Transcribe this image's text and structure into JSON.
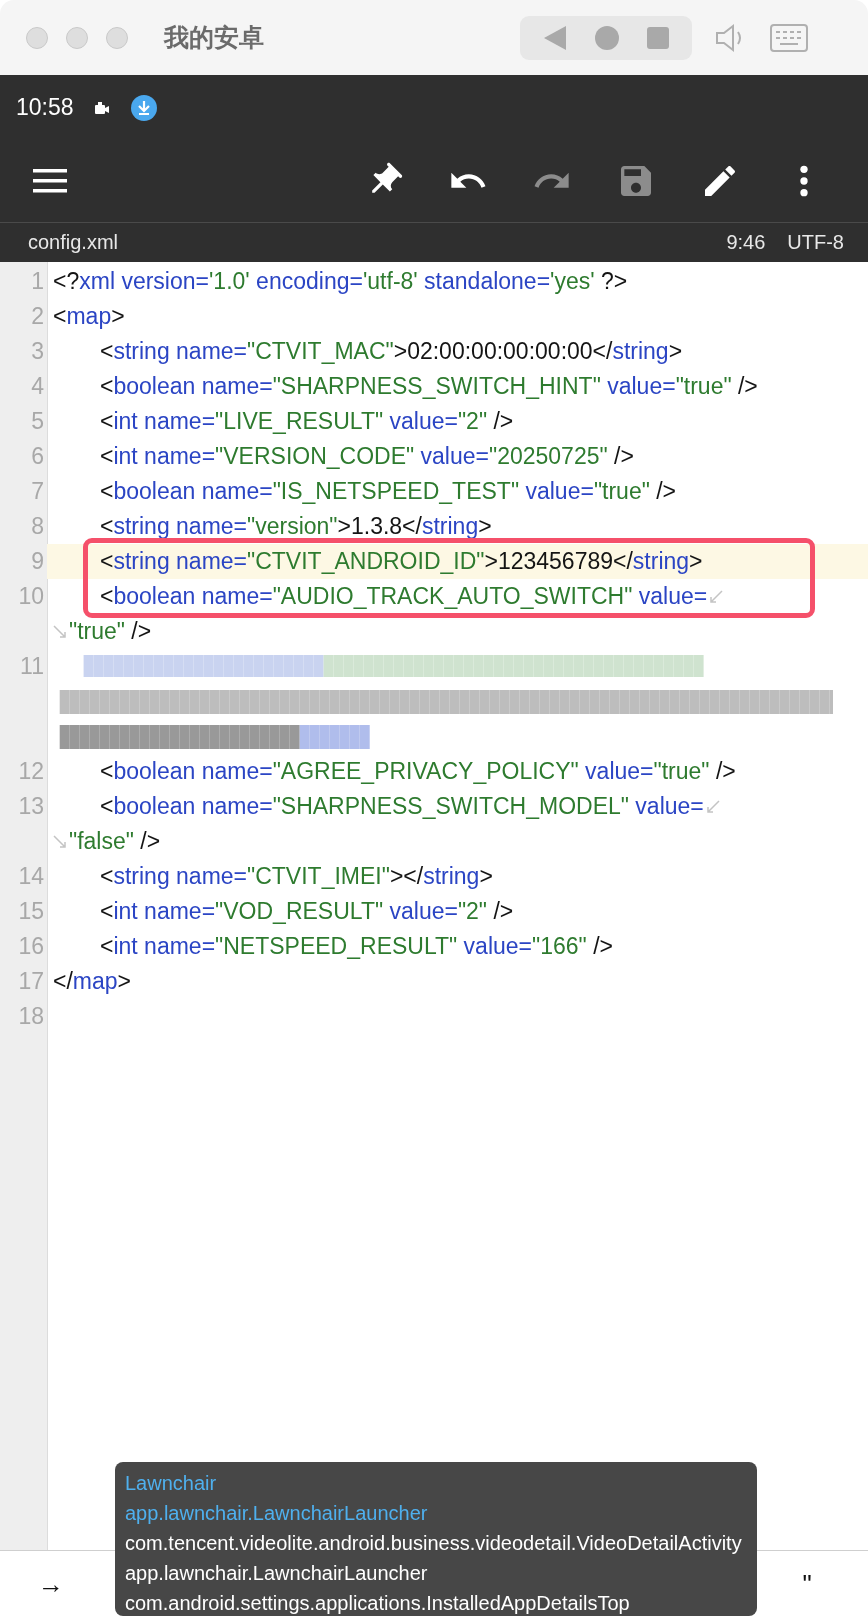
{
  "window": {
    "title": "我的安卓"
  },
  "status_bar": {
    "time": "10:58"
  },
  "toolbar": {
    "actions": [
      {
        "kind": "pin",
        "disabled": false
      },
      {
        "kind": "undo",
        "disabled": false
      },
      {
        "kind": "redo",
        "disabled": true
      },
      {
        "kind": "save",
        "disabled": true
      },
      {
        "kind": "edit",
        "disabled": false
      },
      {
        "kind": "more",
        "disabled": false
      }
    ]
  },
  "file_bar": {
    "name": "config.xml",
    "position": "9:46",
    "encoding": "UTF-8"
  },
  "editor": {
    "lines": [
      {
        "number": "1",
        "kind": "code",
        "selected": false,
        "boxed": false,
        "tokens": [
          {
            "kind": "text",
            "text": "<?"
          },
          {
            "kind": "tag",
            "text": "xml version="
          },
          {
            "kind": "value",
            "text": "'1.0'"
          },
          {
            "kind": "tag",
            "text": " encoding="
          },
          {
            "kind": "value",
            "text": "'utf-8'"
          },
          {
            "kind": "tag",
            "text": " standalone="
          },
          {
            "kind": "value",
            "text": "'yes'"
          },
          {
            "kind": "text",
            "text": " ?>"
          }
        ]
      },
      {
        "number": "2",
        "kind": "code",
        "selected": false,
        "boxed": false,
        "tokens": [
          {
            "kind": "text",
            "text": "<"
          },
          {
            "kind": "tag",
            "text": "map"
          },
          {
            "kind": "text",
            "text": ">"
          }
        ],
        "children": [
          {
            "number": "3",
            "kind": "code",
            "selected": false,
            "boxed": false,
            "tokens": [
              {
                "kind": "text",
                "text": "<"
              },
              {
                "kind": "tag",
                "text": "string name="
              },
              {
                "kind": "value",
                "text": "\"CTVIT_MAC\""
              },
              {
                "kind": "text",
                "text": ">02:00:00:00:00:00</"
              },
              {
                "kind": "tag",
                "text": "string"
              },
              {
                "kind": "text",
                "text": ">"
              }
            ]
          },
          {
            "number": "4",
            "kind": "code",
            "selected": false,
            "boxed": false,
            "tokens": [
              {
                "kind": "text",
                "text": "<"
              },
              {
                "kind": "tag",
                "text": "boolean name="
              },
              {
                "kind": "value",
                "text": "\"SHARPNESS_SWITCH_HINT\""
              },
              {
                "kind": "tag",
                "text": " value="
              },
              {
                "kind": "value",
                "text": "\"true\""
              },
              {
                "kind": "text",
                "text": " />"
              }
            ]
          },
          {
            "number": "5",
            "kind": "code",
            "selected": false,
            "boxed": false,
            "tokens": [
              {
                "kind": "text",
                "text": "<"
              },
              {
                "kind": "tag",
                "text": "int name="
              },
              {
                "kind": "value",
                "text": "\"LIVE_RESULT\""
              },
              {
                "kind": "tag",
                "text": " value="
              },
              {
                "kind": "value",
                "text": "\"2\""
              },
              {
                "kind": "text",
                "text": " />"
              }
            ]
          },
          {
            "number": "6",
            "kind": "code",
            "selected": false,
            "boxed": false,
            "tokens": [
              {
                "kind": "text",
                "text": "<"
              },
              {
                "kind": "tag",
                "text": "int name="
              },
              {
                "kind": "value",
                "text": "\"VERSION_CODE\""
              },
              {
                "kind": "tag",
                "text": " value="
              },
              {
                "kind": "value",
                "text": "\"20250725\""
              },
              {
                "kind": "text",
                "text": " />"
              }
            ]
          },
          {
            "number": "7",
            "kind": "code",
            "selected": false,
            "boxed": false,
            "tokens": [
              {
                "kind": "text",
                "text": "<"
              },
              {
                "kind": "tag",
                "text": "boolean name="
              },
              {
                "kind": "value",
                "text": "\"IS_NETSPEED_TEST\""
              },
              {
                "kind": "tag",
                "text": " value="
              },
              {
                "kind": "value",
                "text": "\"true\""
              },
              {
                "kind": "text",
                "text": " />"
              }
            ]
          },
          {
            "number": "8",
            "kind": "code",
            "selected": false,
            "boxed": false,
            "tokens": [
              {
                "kind": "text",
                "text": "<"
              },
              {
                "kind": "tag",
                "text": "string name="
              },
              {
                "kind": "value",
                "text": "\"version\""
              },
              {
                "kind": "text",
                "text": ">1.3.8</"
              },
              {
                "kind": "tag",
                "text": "string"
              },
              {
                "kind": "text",
                "text": ">"
              }
            ]
          },
          {
            "number": "9",
            "kind": "code",
            "selected": true,
            "boxed": true,
            "tokens": [
              {
                "kind": "text",
                "text": "<"
              },
              {
                "kind": "tag",
                "text": "string name="
              },
              {
                "kind": "value",
                "text": "\"CTVIT_ANDROID_ID\""
              },
              {
                "kind": "text",
                "text": ">123456789</"
              },
              {
                "kind": "tag",
                "text": "string"
              },
              {
                "kind": "text",
                "text": ">"
              }
            ]
          },
          {
            "number": "10",
            "kind": "code",
            "selected": false,
            "boxed": true,
            "tokens": [
              {
                "kind": "text",
                "text": "<"
              },
              {
                "kind": "tag",
                "text": "boolean name="
              },
              {
                "kind": "value",
                "text": "\"AUDIO_TRACK_AUTO_SWITCH\""
              },
              {
                "kind": "tag",
                "text": " value="
              }
            ],
            "wrap": [
              {
                "kind": "value",
                "text": "\"true\""
              },
              {
                "kind": "text",
                "text": " />"
              }
            ]
          },
          {
            "number": "11",
            "kind": "blurred",
            "selected": false,
            "boxed": false
          },
          {
            "number": "12",
            "kind": "code",
            "selected": false,
            "boxed": false,
            "tokens": [
              {
                "kind": "text",
                "text": "<"
              },
              {
                "kind": "tag",
                "text": "boolean name="
              },
              {
                "kind": "value",
                "text": "\"AGREE_PRIVACY_POLICY\""
              },
              {
                "kind": "tag",
                "text": " value="
              },
              {
                "kind": "value",
                "text": "\"true\""
              },
              {
                "kind": "text",
                "text": " />"
              }
            ]
          },
          {
            "number": "13",
            "kind": "code",
            "selected": false,
            "boxed": false,
            "tokens": [
              {
                "kind": "text",
                "text": "<"
              },
              {
                "kind": "tag",
                "text": "boolean name="
              },
              {
                "kind": "value",
                "text": "\"SHARPNESS_SWITCH_MODEL\""
              },
              {
                "kind": "tag",
                "text": " value="
              }
            ],
            "wrap": [
              {
                "kind": "value",
                "text": "\"false\""
              },
              {
                "kind": "text",
                "text": " />"
              }
            ]
          },
          {
            "number": "14",
            "kind": "code",
            "selected": false,
            "boxed": false,
            "tokens": [
              {
                "kind": "text",
                "text": "<"
              },
              {
                "kind": "tag",
                "text": "string name="
              },
              {
                "kind": "value",
                "text": "\"CTVIT_IMEI\""
              },
              {
                "kind": "text",
                "text": "></"
              },
              {
                "kind": "tag",
                "text": "string"
              },
              {
                "kind": "text",
                "text": ">"
              }
            ]
          },
          {
            "number": "15",
            "kind": "code",
            "selected": false,
            "boxed": false,
            "tokens": [
              {
                "kind": "text",
                "text": "<"
              },
              {
                "kind": "tag",
                "text": "int name="
              },
              {
                "kind": "value",
                "text": "\"VOD_RESULT\""
              },
              {
                "kind": "tag",
                "text": " value="
              },
              {
                "kind": "value",
                "text": "\"2\""
              },
              {
                "kind": "text",
                "text": " />"
              }
            ]
          },
          {
            "number": "16",
            "kind": "code",
            "selected": false,
            "boxed": false,
            "tokens": [
              {
                "kind": "text",
                "text": "<"
              },
              {
                "kind": "tag",
                "text": "int name="
              },
              {
                "kind": "value",
                "text": "\"NETSPEED_RESULT\""
              },
              {
                "kind": "tag",
                "text": " value="
              },
              {
                "kind": "value",
                "text": "\"166\""
              },
              {
                "kind": "text",
                "text": " />"
              }
            ]
          }
        ]
      },
      {
        "number": "17",
        "kind": "code",
        "selected": false,
        "boxed": false,
        "tokens": [
          {
            "kind": "text",
            "text": "</"
          },
          {
            "kind": "tag",
            "text": "map"
          },
          {
            "kind": "text",
            "text": ">"
          }
        ]
      },
      {
        "number": "18",
        "kind": "code",
        "selected": false,
        "boxed": false
      }
    ]
  },
  "key_bar": {
    "keys": [
      "→",
      "\""
    ]
  },
  "toast": {
    "lines": [
      {
        "text": "Lawnchair",
        "color": "#4fb0ee"
      },
      {
        "text": "app.lawnchair.LawnchairLauncher",
        "color": "#4fb0ee"
      },
      {
        "text": "com.tencent.videolite.android.business.videodetail.VideoDetailActivity",
        "color": "#ffffff"
      },
      {
        "text": "app.lawnchair.LawnchairLauncher",
        "color": "#ffffff"
      },
      {
        "text": "com.android.settings.applications.InstalledAppDetailsTop",
        "color": "#ffffff"
      }
    ]
  }
}
